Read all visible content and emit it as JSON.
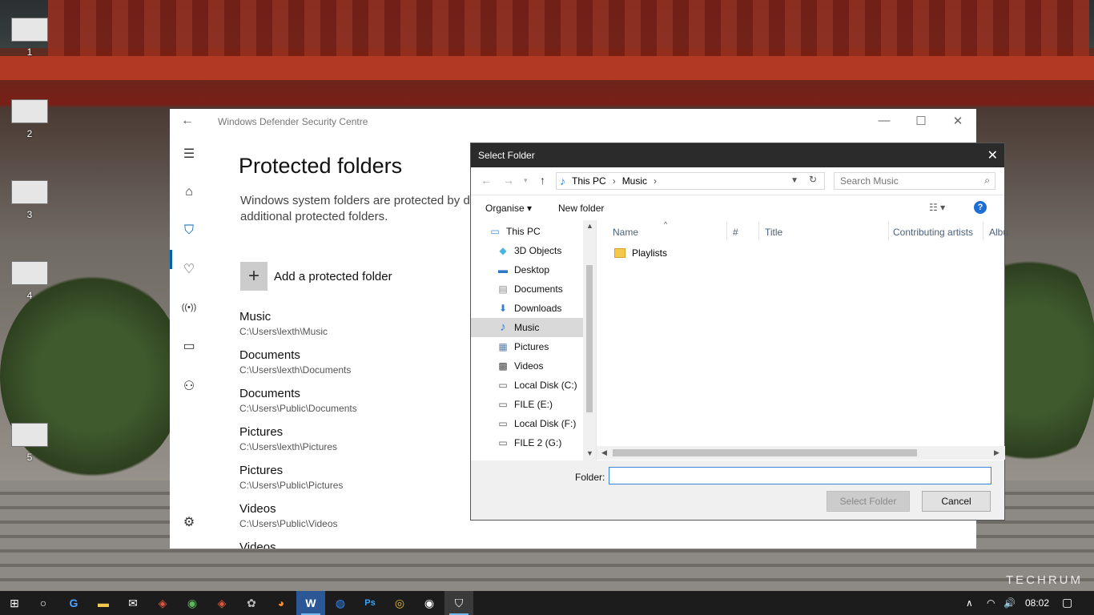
{
  "desktop": {
    "icons": [
      {
        "label": "1"
      },
      {
        "label": "2"
      },
      {
        "label": "3"
      },
      {
        "label": "4"
      },
      {
        "label": "5"
      }
    ],
    "watermark": "TECHRUM"
  },
  "defender": {
    "title": "Windows Defender Security Centre",
    "back_icon": "back-arrow-icon",
    "controls": {
      "minimize": "—",
      "maximize": "☐",
      "close": "✕"
    },
    "nav": [
      {
        "icon": "hamburger-menu-icon",
        "glyph": "☰"
      },
      {
        "icon": "home-icon",
        "glyph": "⌂"
      },
      {
        "icon": "shield-icon",
        "glyph": "⛉"
      },
      {
        "icon": "heart-pulse-icon",
        "glyph": "♡"
      },
      {
        "icon": "network-antenna-icon",
        "glyph": "((•))"
      },
      {
        "icon": "app-browser-icon",
        "glyph": "▭"
      },
      {
        "icon": "family-icon",
        "glyph": "⚇"
      },
      {
        "icon": "settings-gear-icon",
        "glyph": "⚙"
      }
    ],
    "heading": "Protected folders",
    "description": "Windows system folders are protected by d additional protected folders.",
    "add_button_label": "Add a protected folder",
    "folders": [
      {
        "name": "Music",
        "path": "C:\\Users\\lexth\\Music"
      },
      {
        "name": "Documents",
        "path": "C:\\Users\\lexth\\Documents"
      },
      {
        "name": "Documents",
        "path": "C:\\Users\\Public\\Documents"
      },
      {
        "name": "Pictures",
        "path": "C:\\Users\\lexth\\Pictures"
      },
      {
        "name": "Pictures",
        "path": "C:\\Users\\Public\\Pictures"
      },
      {
        "name": "Videos",
        "path": "C:\\Users\\Public\\Videos"
      },
      {
        "name": "Videos",
        "path": ""
      }
    ]
  },
  "dialog": {
    "title": "Select Folder",
    "close_glyph": "✕",
    "breadcrumb": [
      "This PC",
      "Music"
    ],
    "search_placeholder": "Search Music",
    "commands": {
      "organise": "Organise ▾",
      "new_folder": "New folder",
      "help": "?"
    },
    "tree": [
      {
        "label": "This PC",
        "icon": "computer-icon",
        "glyph": "🖥",
        "color": "#3a8ad6"
      },
      {
        "label": "3D Objects",
        "icon": "3d-cube-icon",
        "glyph": "◆",
        "color": "#4fb3e0"
      },
      {
        "label": "Desktop",
        "icon": "desktop-icon",
        "glyph": "▬",
        "color": "#2b79c9"
      },
      {
        "label": "Documents",
        "icon": "documents-icon",
        "glyph": "▤",
        "color": "#8a8a8a"
      },
      {
        "label": "Downloads",
        "icon": "downloads-arrow-icon",
        "glyph": "⬇",
        "color": "#2f7fd3"
      },
      {
        "label": "Music",
        "icon": "music-note-icon",
        "glyph": "♪",
        "color": "#2f7fd3"
      },
      {
        "label": "Pictures",
        "icon": "pictures-icon",
        "glyph": "▦",
        "color": "#5a7fa8"
      },
      {
        "label": "Videos",
        "icon": "videos-film-icon",
        "glyph": "▩",
        "color": "#444444"
      },
      {
        "label": "Local Disk (C:)",
        "icon": "windows-drive-icon",
        "glyph": "▭",
        "color": "#555555"
      },
      {
        "label": "FILE (E:)",
        "icon": "drive-icon",
        "glyph": "▭",
        "color": "#555555"
      },
      {
        "label": "Local Disk (F:)",
        "icon": "drive-icon",
        "glyph": "▭",
        "color": "#555555"
      },
      {
        "label": "FILE 2 (G:)",
        "icon": "drive-icon",
        "glyph": "▭",
        "color": "#555555"
      }
    ],
    "selected_tree_item": "Music",
    "columns": [
      "Name",
      "#",
      "Title",
      "Contributing artists",
      "Albu"
    ],
    "files": [
      {
        "name": "Playlists",
        "type": "folder"
      }
    ],
    "folder_label": "Folder:",
    "folder_value": "",
    "buttons": {
      "select": "Select Folder",
      "cancel": "Cancel"
    }
  },
  "taskbar": {
    "items": [
      {
        "icon": "windows-start-icon",
        "glyph": "⊞"
      },
      {
        "icon": "cortana-circle-icon",
        "glyph": "○"
      },
      {
        "icon": "gotv-icon",
        "glyph": "G"
      },
      {
        "icon": "file-explorer-icon",
        "glyph": "▬"
      },
      {
        "icon": "mail-icon",
        "glyph": "✉"
      },
      {
        "icon": "app-icon",
        "glyph": "◈"
      },
      {
        "icon": "app-icon",
        "glyph": "◉"
      },
      {
        "icon": "app-icon",
        "glyph": "◈"
      },
      {
        "icon": "app-icon",
        "glyph": "✿"
      },
      {
        "icon": "firefox-icon",
        "glyph": "◕"
      },
      {
        "icon": "word-icon",
        "glyph": "W"
      },
      {
        "icon": "messenger-icon",
        "glyph": "◍"
      },
      {
        "icon": "photoshop-icon",
        "glyph": "Ps"
      },
      {
        "icon": "chrome-icon",
        "glyph": "◎"
      },
      {
        "icon": "media-icon",
        "glyph": "◉"
      },
      {
        "icon": "defender-shield-icon",
        "glyph": "⛉"
      }
    ],
    "tray": {
      "chevron": "∧",
      "wifi": "◠",
      "volume": "🔊",
      "notifications": "▢"
    },
    "clock": "08:02"
  }
}
